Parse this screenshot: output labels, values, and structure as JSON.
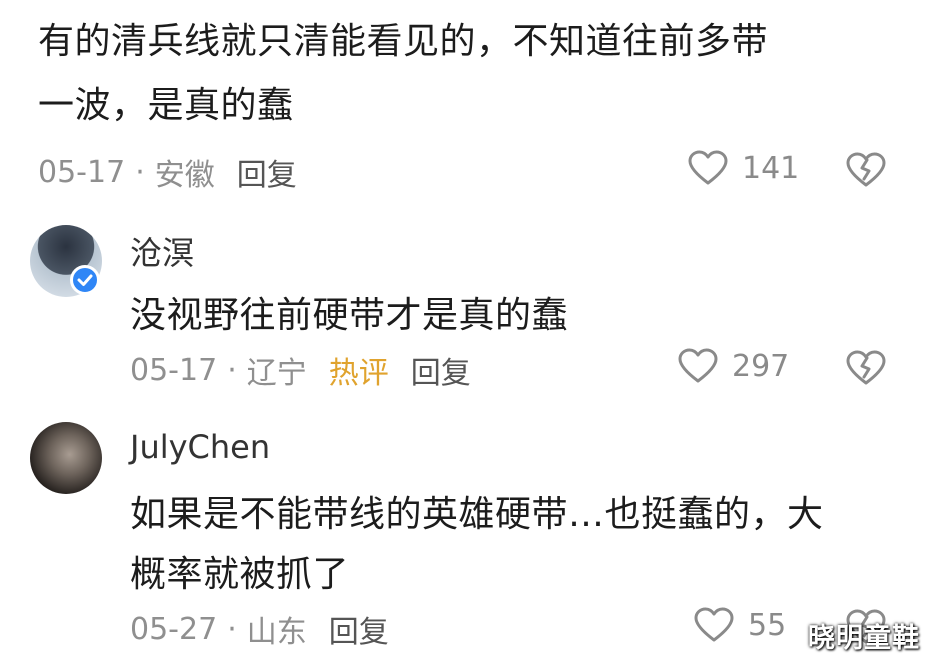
{
  "comment_top": {
    "text_line1": "有的清兵线就只清能看见的，不知道往前多带",
    "text_line2": "一波，是真的蠢",
    "date": "05-17",
    "location": "安徽",
    "reply_label": "回复",
    "like_count": "141"
  },
  "reply_1": {
    "username": "沧溟",
    "text": "没视野往前硬带才是真的蠢",
    "date": "05-17",
    "location": "辽宁",
    "hot_tag": "热评",
    "reply_label": "回复",
    "like_count": "297"
  },
  "reply_2": {
    "username": "JulyChen",
    "text_line1": "如果是不能带线的英雄硬带…也挺蠢的，大",
    "text_line2": "概率就被抓了",
    "date": "05-27",
    "location": "山东",
    "reply_label": "回复",
    "like_count": "55"
  },
  "watermark": "晓明童鞋",
  "separator": "·",
  "colors": {
    "hot_tag": "#e0a32e",
    "verified_badge": "#2f86f6",
    "meta_text": "#8f8f8f"
  },
  "icons": [
    "heart-outline-icon",
    "broken-heart-icon",
    "verified-badge-icon"
  ]
}
